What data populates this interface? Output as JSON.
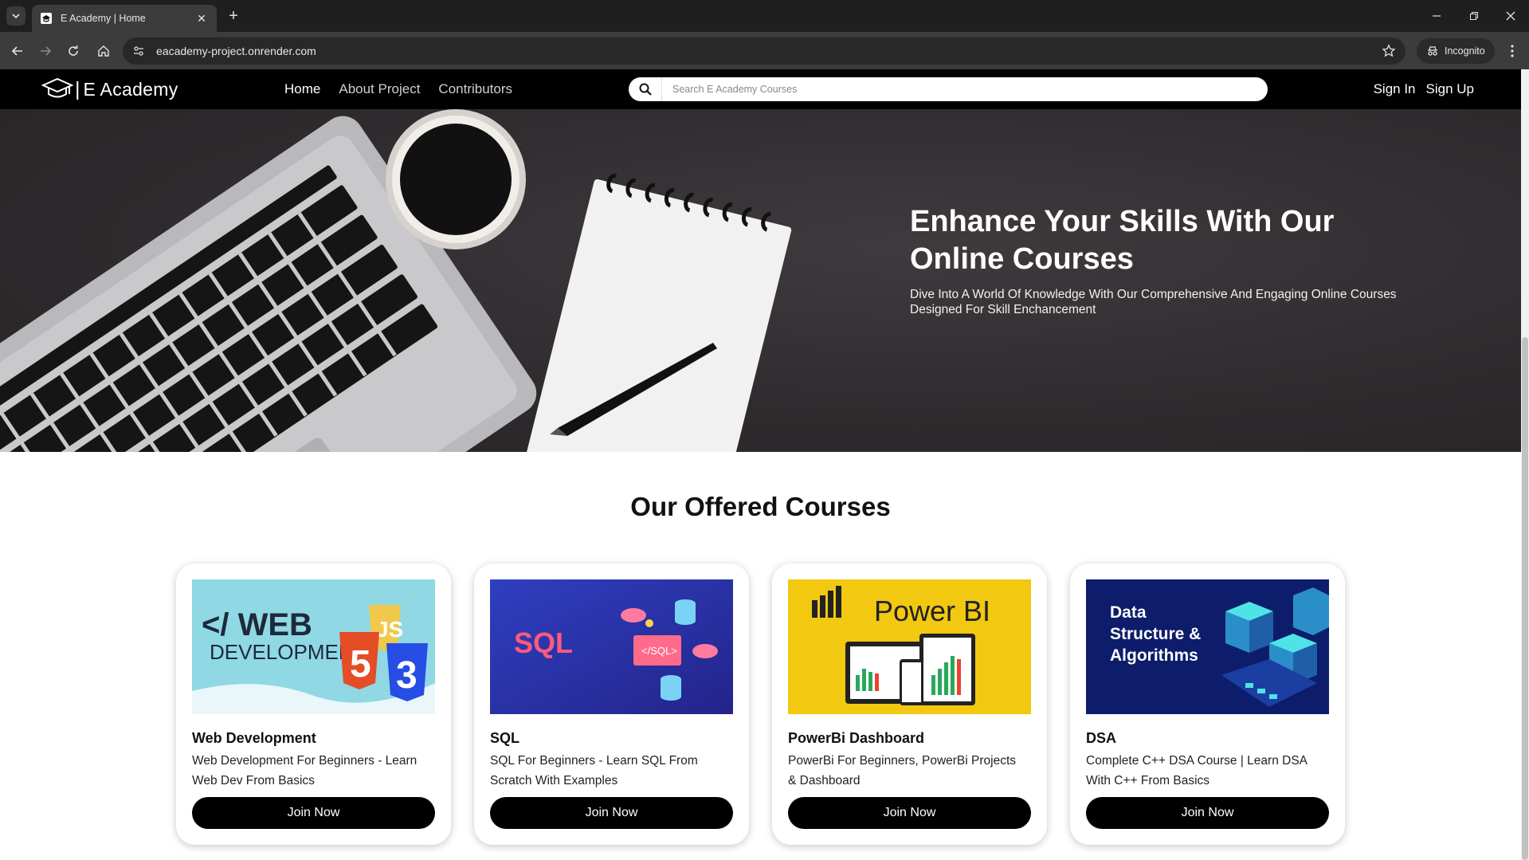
{
  "browser": {
    "tab_title": "E Academy | Home",
    "url": "eacademy-project.onrender.com",
    "incognito_label": "Incognito"
  },
  "site": {
    "logo_text": "E Academy",
    "nav": [
      "Home",
      "About Project",
      "Contributors"
    ],
    "search_placeholder": "Search E Academy Courses",
    "sign_in": "Sign In",
    "sign_up": "Sign Up"
  },
  "hero": {
    "title_line1": "Enhance Your Skills With Our",
    "title_line2": "Online Courses",
    "subtitle_line1": "Dive Into A World Of Knowledge With Our Comprehensive And Engaging Online Courses",
    "subtitle_line2": "Designed For Skill Enchancement"
  },
  "courses": {
    "section_title": "Our Offered Courses",
    "items": [
      {
        "title": "Web Development",
        "desc": "Web Development For Beginners - Learn Web Dev From Basics",
        "button": "Join Now",
        "image_text_1": "</ WEB",
        "image_text_2": "DEVELOPMENT>",
        "image_text_3": "5",
        "image_text_4": "3",
        "image_text_5": "JS"
      },
      {
        "title": "SQL",
        "desc": "SQL For Beginners - Learn SQL From Scratch With Examples",
        "button": "Join Now",
        "image_text_1": "SQL",
        "image_text_2": "</SQL>"
      },
      {
        "title": "PowerBi Dashboard",
        "desc": "PowerBi For Beginners, PowerBi Projects & Dashboard",
        "button": "Join Now",
        "image_text_1": "Power BI"
      },
      {
        "title": "DSA",
        "desc": "Complete C++ DSA Course | Learn DSA With C++ From Basics",
        "button": "Join Now",
        "image_text_1": "Data",
        "image_text_2": "Structure &",
        "image_text_3": "Algorithms"
      }
    ]
  },
  "colors": {
    "nav_bg": "#000000",
    "hero_bg": "#2e2a2d",
    "button_bg": "#000000",
    "sql_bg": "#2a2f9e",
    "powerbi_bg": "#f2c811",
    "dsa_bg": "#0d1d6b",
    "web_bg": "#8fd8e4"
  },
  "icons": [
    "chevron-down-icon",
    "site-favicon-icon",
    "close-icon",
    "plus-icon",
    "back-icon",
    "forward-icon",
    "reload-icon",
    "home-icon",
    "site-info-icon",
    "star-icon",
    "incognito-icon",
    "kebab-menu-icon",
    "graduation-cap-icon",
    "search-icon"
  ]
}
